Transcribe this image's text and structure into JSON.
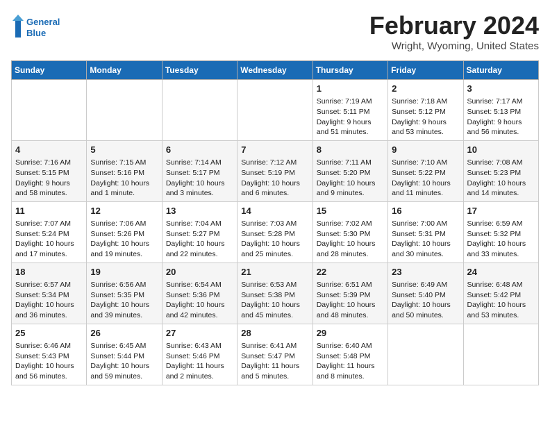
{
  "header": {
    "logo_text_general": "General",
    "logo_text_blue": "Blue",
    "month_title": "February 2024",
    "location": "Wright, Wyoming, United States"
  },
  "weekdays": [
    "Sunday",
    "Monday",
    "Tuesday",
    "Wednesday",
    "Thursday",
    "Friday",
    "Saturday"
  ],
  "weeks": [
    [
      {
        "day": "",
        "info": ""
      },
      {
        "day": "",
        "info": ""
      },
      {
        "day": "",
        "info": ""
      },
      {
        "day": "",
        "info": ""
      },
      {
        "day": "1",
        "info": "Sunrise: 7:19 AM\nSunset: 5:11 PM\nDaylight: 9 hours\nand 51 minutes."
      },
      {
        "day": "2",
        "info": "Sunrise: 7:18 AM\nSunset: 5:12 PM\nDaylight: 9 hours\nand 53 minutes."
      },
      {
        "day": "3",
        "info": "Sunrise: 7:17 AM\nSunset: 5:13 PM\nDaylight: 9 hours\nand 56 minutes."
      }
    ],
    [
      {
        "day": "4",
        "info": "Sunrise: 7:16 AM\nSunset: 5:15 PM\nDaylight: 9 hours\nand 58 minutes."
      },
      {
        "day": "5",
        "info": "Sunrise: 7:15 AM\nSunset: 5:16 PM\nDaylight: 10 hours\nand 1 minute."
      },
      {
        "day": "6",
        "info": "Sunrise: 7:14 AM\nSunset: 5:17 PM\nDaylight: 10 hours\nand 3 minutes."
      },
      {
        "day": "7",
        "info": "Sunrise: 7:12 AM\nSunset: 5:19 PM\nDaylight: 10 hours\nand 6 minutes."
      },
      {
        "day": "8",
        "info": "Sunrise: 7:11 AM\nSunset: 5:20 PM\nDaylight: 10 hours\nand 9 minutes."
      },
      {
        "day": "9",
        "info": "Sunrise: 7:10 AM\nSunset: 5:22 PM\nDaylight: 10 hours\nand 11 minutes."
      },
      {
        "day": "10",
        "info": "Sunrise: 7:08 AM\nSunset: 5:23 PM\nDaylight: 10 hours\nand 14 minutes."
      }
    ],
    [
      {
        "day": "11",
        "info": "Sunrise: 7:07 AM\nSunset: 5:24 PM\nDaylight: 10 hours\nand 17 minutes."
      },
      {
        "day": "12",
        "info": "Sunrise: 7:06 AM\nSunset: 5:26 PM\nDaylight: 10 hours\nand 19 minutes."
      },
      {
        "day": "13",
        "info": "Sunrise: 7:04 AM\nSunset: 5:27 PM\nDaylight: 10 hours\nand 22 minutes."
      },
      {
        "day": "14",
        "info": "Sunrise: 7:03 AM\nSunset: 5:28 PM\nDaylight: 10 hours\nand 25 minutes."
      },
      {
        "day": "15",
        "info": "Sunrise: 7:02 AM\nSunset: 5:30 PM\nDaylight: 10 hours\nand 28 minutes."
      },
      {
        "day": "16",
        "info": "Sunrise: 7:00 AM\nSunset: 5:31 PM\nDaylight: 10 hours\nand 30 minutes."
      },
      {
        "day": "17",
        "info": "Sunrise: 6:59 AM\nSunset: 5:32 PM\nDaylight: 10 hours\nand 33 minutes."
      }
    ],
    [
      {
        "day": "18",
        "info": "Sunrise: 6:57 AM\nSunset: 5:34 PM\nDaylight: 10 hours\nand 36 minutes."
      },
      {
        "day": "19",
        "info": "Sunrise: 6:56 AM\nSunset: 5:35 PM\nDaylight: 10 hours\nand 39 minutes."
      },
      {
        "day": "20",
        "info": "Sunrise: 6:54 AM\nSunset: 5:36 PM\nDaylight: 10 hours\nand 42 minutes."
      },
      {
        "day": "21",
        "info": "Sunrise: 6:53 AM\nSunset: 5:38 PM\nDaylight: 10 hours\nand 45 minutes."
      },
      {
        "day": "22",
        "info": "Sunrise: 6:51 AM\nSunset: 5:39 PM\nDaylight: 10 hours\nand 48 minutes."
      },
      {
        "day": "23",
        "info": "Sunrise: 6:49 AM\nSunset: 5:40 PM\nDaylight: 10 hours\nand 50 minutes."
      },
      {
        "day": "24",
        "info": "Sunrise: 6:48 AM\nSunset: 5:42 PM\nDaylight: 10 hours\nand 53 minutes."
      }
    ],
    [
      {
        "day": "25",
        "info": "Sunrise: 6:46 AM\nSunset: 5:43 PM\nDaylight: 10 hours\nand 56 minutes."
      },
      {
        "day": "26",
        "info": "Sunrise: 6:45 AM\nSunset: 5:44 PM\nDaylight: 10 hours\nand 59 minutes."
      },
      {
        "day": "27",
        "info": "Sunrise: 6:43 AM\nSunset: 5:46 PM\nDaylight: 11 hours\nand 2 minutes."
      },
      {
        "day": "28",
        "info": "Sunrise: 6:41 AM\nSunset: 5:47 PM\nDaylight: 11 hours\nand 5 minutes."
      },
      {
        "day": "29",
        "info": "Sunrise: 6:40 AM\nSunset: 5:48 PM\nDaylight: 11 hours\nand 8 minutes."
      },
      {
        "day": "",
        "info": ""
      },
      {
        "day": "",
        "info": ""
      }
    ]
  ]
}
